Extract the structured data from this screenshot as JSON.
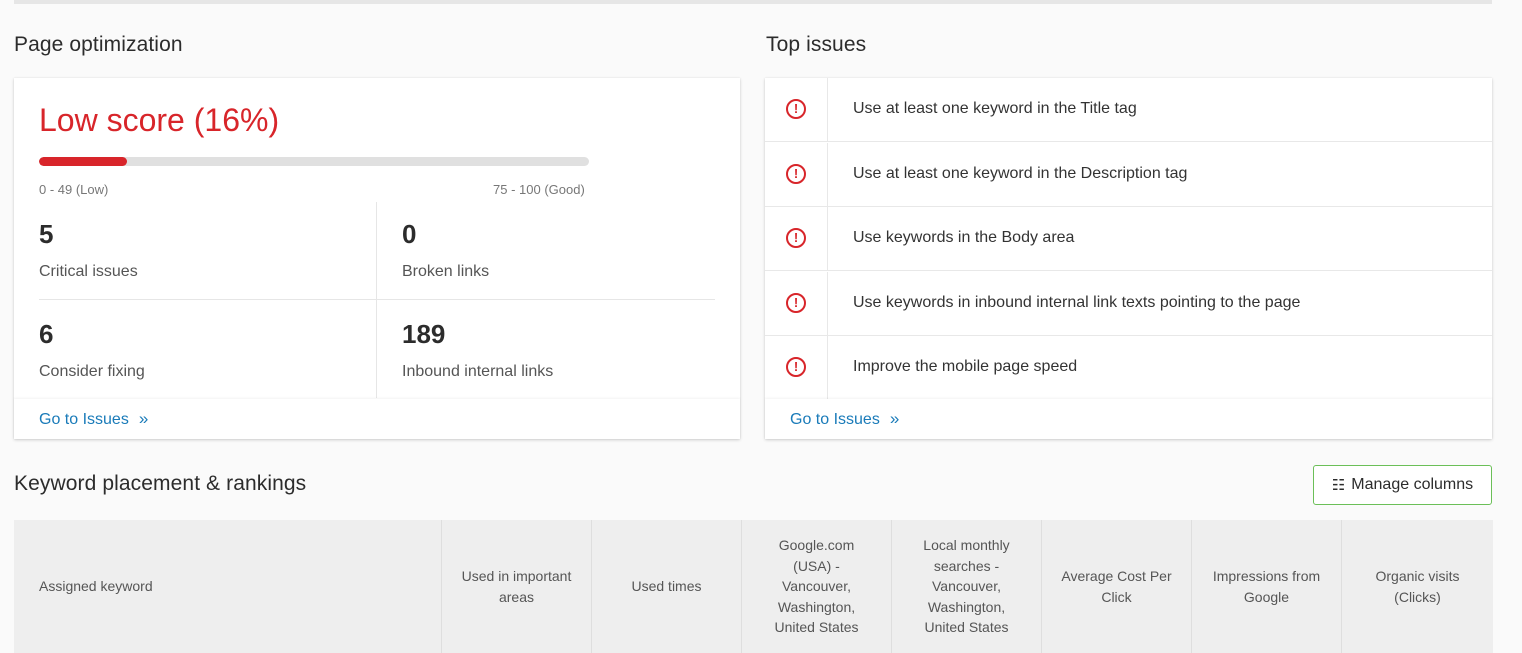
{
  "page_optimization": {
    "title": "Page optimization",
    "score_label": "Low score (16%)",
    "score_percent": 16,
    "range_low": "0 - 49 (Low)",
    "range_good": "75 - 100 (Good)",
    "stats": [
      {
        "value": "5",
        "label": "Critical issues"
      },
      {
        "value": "0",
        "label": "Broken links"
      },
      {
        "value": "6",
        "label": "Consider fixing"
      },
      {
        "value": "189",
        "label": "Inbound internal links"
      }
    ],
    "goto_label": "Go to Issues",
    "goto_chevron": "»"
  },
  "top_issues": {
    "title": "Top issues",
    "icon": "alert-circle-icon",
    "items": [
      "Use at least one keyword in the Title tag",
      "Use at least one keyword in the Description tag",
      "Use keywords in the Body area",
      "Use keywords in inbound internal link texts pointing to the page",
      "Improve the mobile page speed"
    ],
    "goto_label": "Go to Issues",
    "goto_chevron": "»"
  },
  "keywords": {
    "title": "Keyword placement & rankings",
    "manage_columns_label": "Manage columns",
    "columns": [
      "Assigned keyword",
      "Used in important areas",
      "Used times",
      "Google.com (USA) - Vancouver, Washington, United States",
      "Local monthly searches - Vancouver, Washington, United States",
      "Average Cost Per Click",
      "Impressions from Google",
      "Organic visits (Clicks)"
    ]
  },
  "colors": {
    "critical": "#d8252a",
    "link": "#1a7bb9",
    "button_border": "#6bbf58"
  }
}
